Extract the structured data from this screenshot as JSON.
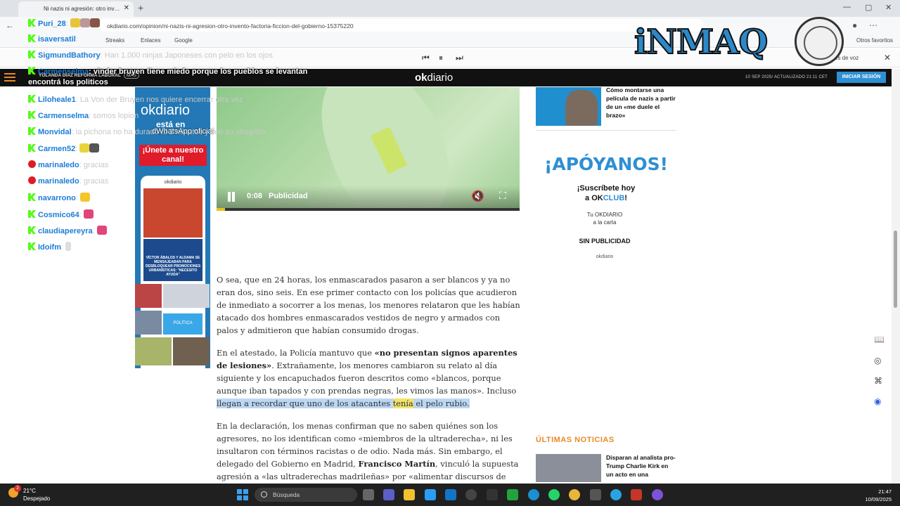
{
  "browser": {
    "tab_title": "Ni nazis ni agresión: otro inv…",
    "url": "okdiario.com/opinion/ni-nazis-ni-agresion-otro-invento-factoria-ficcion-del-gobierno-15375220",
    "bookmarks": [
      "Streaks",
      "Enlaces",
      "Google"
    ],
    "bookmarks_right": "Otros favoritos",
    "voice_label": "es de voz"
  },
  "site": {
    "logo_ok": "ok",
    "logo_diario": "diario",
    "date": "10 SEP 2025/ ACTUALIZADO 21:11 CET",
    "login": "INICIAR SESIÓN",
    "ticker": "YOLANDA DÍAZ REFORMA LABORAL",
    "ticker_more": "MÁS"
  },
  "left_ad": {
    "logo": "okdiario",
    "line1": "está en",
    "join": "¡Únete a nuestro canal!",
    "phone_top": "okdiario",
    "phone_card": "VÍCTOR ÁBALOS Y ALDAMA SE MENSAJEABAN PARA DESBLOQUEAR PROMOCIONES URBANÍSTICAS: \"NECESITO AYUDA\"",
    "politica": "POLÍTICA"
  },
  "video": {
    "time": "0:08",
    "ad_label": "Publicidad"
  },
  "article": {
    "p1": "O sea, que en 24 horas, los enmascarados pasaron a ser blancos y ya no eran dos, sino seis. En ese primer contacto con los policías que acudieron de inmediato a socorrer a los menas, los menores relataron que les habían atacado dos hombres enmascarados vestidos de negro y armados con palos y admitieron que habían consumido drogas.",
    "p2_a": "En el  atestado, la Policía mantuvo que ",
    "p2_b": "«no presentan signos aparentes de lesiones»",
    "p2_c": ". Extrañamente, los menores cambiaron su relato al día siguiente y los encapuchados fueron descritos como  «blancos, porque aunque iban tapados y con prendas negras, les vimos las manos». Incluso ",
    "p2_d": "llegan a recordar que uno de los atacantes ",
    "p2_e": "tenía",
    "p2_f": " el pelo rubio.",
    "p3_a": "En la declaración, los menas confirman que no saben quiénes son los agresores, no los identifican como «miembros de la ultraderecha», ni les insultaron con términos racistas o de odio. Nada más. Sin embargo, el delegado del Gobierno en Madrid, ",
    "p3_b": "Francisco Martín",
    "p3_c": ", vinculó la supuesta agresión a «las ultraderechas madrileñas» por «alimentar discursos de"
  },
  "right_col": {
    "headline1": "Cómo montarse una película de nazis a partir de un «me duele el brazo»",
    "apoyanos": "¡APÓYANOS!",
    "suscribete": "¡Suscríbete hoy",
    "a_ok": "a OK",
    "club": "CLUB",
    "bang": "!",
    "carta_1": "Tu OKDIARIO",
    "carta_2": "a la carta",
    "sin_publicidad": "SIN PUBLICIDAD",
    "ok_small": "okdiario",
    "ultimas": "ÚLTIMAS NOTICIAS",
    "headline2": "Disparan al analista pro-Trump Charlie Kirk en un acto en una"
  },
  "chat": [
    {
      "platform": "kick",
      "user": "Puri_28",
      "msg": ""
    },
    {
      "platform": "kick",
      "user": "isaversatil",
      "msg": ""
    },
    {
      "platform": "kick",
      "user": "SigmundBathory",
      "msg": "Han 1.000 ninjas Japoneses con pelo en los ojos"
    },
    {
      "platform": "kick",
      "user": "Carmenselma",
      "msg": "vinder bruyen tiene miedo porque los pueblos se levantan",
      "msg2": "encontrá los politicos"
    },
    {
      "platform": "kick",
      "user": "Liloheale1",
      "msg": "La Von der Bruyen nos quiere encerrar otra vez"
    },
    {
      "platform": "kick",
      "user": "Carmenselma",
      "msg": "somos lopion"
    },
    {
      "platform": "kick",
      "user": "Monvidal",
      "msg": "la pichona no ha durado ni 2 minutos y con su abogado"
    },
    {
      "platform": "kick",
      "user": "Carmen52",
      "msg": ""
    },
    {
      "platform": "youtube",
      "user": "marinaledo",
      "msg": "gracias"
    },
    {
      "platform": "youtube",
      "user": "marinaledo",
      "msg": "gracias"
    },
    {
      "platform": "kick",
      "user": "navarrono",
      "msg": ""
    },
    {
      "platform": "kick",
      "user": "Cosmico64",
      "msg": ""
    },
    {
      "platform": "kick",
      "user": "claudiapereyra",
      "msg": ""
    },
    {
      "platform": "kick",
      "user": "Idoifm",
      "msg": ""
    }
  ],
  "overlay": {
    "watermark_text": "dWhatsApp oficial",
    "brand": "iNMAQ"
  },
  "taskbar": {
    "temp": "21°C",
    "weather": "Despejado",
    "badge": "2",
    "search": "Búsqueda",
    "time": "21:47",
    "date": "10/09/2025"
  },
  "colors": {
    "accent_blue": "#2e8fd4",
    "ok_orange": "#e88a26",
    "chat_user": "#1c7dd6",
    "kick_green": "#53fc18"
  }
}
